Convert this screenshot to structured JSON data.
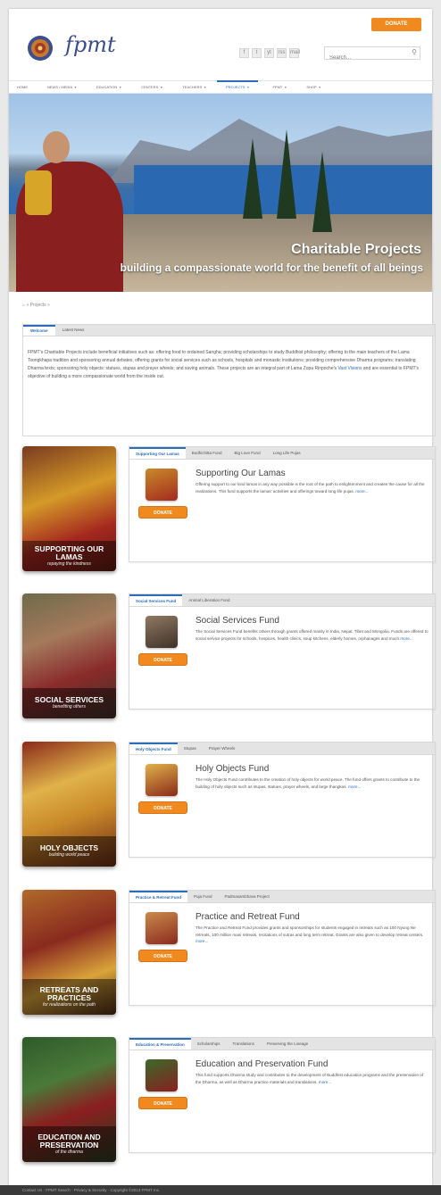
{
  "header": {
    "logo_text": "fpmt",
    "donate_label": "DONATE",
    "social_icons": [
      "f",
      "t",
      "yt",
      "rss",
      "mail"
    ],
    "search_placeholder": "Search...",
    "accent": "#2a6db8",
    "donate_color": "#f0891e"
  },
  "nav": {
    "items": [
      {
        "label": "HOME"
      },
      {
        "label": "NEWS / MEDIA"
      },
      {
        "label": "EDUCATION"
      },
      {
        "label": "CENTERS"
      },
      {
        "label": "TEACHERS"
      },
      {
        "label": "PROJECTS"
      },
      {
        "label": "FPMT"
      },
      {
        "label": "SHOP"
      }
    ],
    "active": "PROJECTS"
  },
  "hero": {
    "title": "Charitable Projects",
    "subtitle": "building a compassionate world for the benefit of all beings"
  },
  "breadcrumb": {
    "current": "Projects"
  },
  "intro": {
    "tabs": [
      "Welcome",
      "Latest News"
    ],
    "text_before_link": "FPMT's Charitable Projects include beneficial initiatives such as: offering food to ordained Sangha; providing scholarships to study Buddhist philosophy; offering to the main teachers of the Lama Tsongkhapa tradition and sponsoring annual debates; offering grants for social services such as schools, hospitals and monastic institutions; providing comprehensive Dharma programs; translating Dharma texts; sponsoring holy objects: statues, stupas and prayer wheels; and saving animals. These projects are an integral part of Lama Zopa Rinpoche's",
    "link": "Vast Visions",
    "text_after_link": "and are essential to FPMT's objective of building a more compassionate world from the inside out."
  },
  "funds": [
    {
      "image_title": "SUPPORTING OUR LAMAS",
      "image_subtitle": "repaying the kindness",
      "tabs": [
        "Supporting Our Lamas",
        "Bodhichitta Fund",
        "Big Love Fund",
        "Long Life Pujas"
      ],
      "title": "Supporting Our Lamas",
      "desc": "Offering support to our kind lamas in any way possible is the root of the path to enlightenment and creates the cause for all the realizations. This fund supports the lamas' activities and offerings toward long life pujas.",
      "more": "more...",
      "donate": "DONATE"
    },
    {
      "image_title": "SOCIAL SERVICES",
      "image_subtitle": "benefiting others",
      "tabs": [
        "Social Services Fund",
        "Animal Liberation Fund"
      ],
      "title": "Social Services Fund",
      "desc": "The Social Services Fund benefits others through grants offered mainly in India, Nepal, Tibet and Mongolia. Funds are offered to social service projects for schools, hospices, health clinics, soup kitchens, elderly homes, orphanages and much",
      "more": "more...",
      "donate": "DONATE"
    },
    {
      "image_title": "HOLY OBJECTS",
      "image_subtitle": "building world peace",
      "tabs": [
        "Holy Objects Fund",
        "Stupas",
        "Prayer Wheels"
      ],
      "title": "Holy Objects Fund",
      "desc": "The Holy Objects Fund contributes to the creation of holy objects for world peace. The fund offers grants to contribute to the building of holy objects such as stupas, statues, prayer wheels, and large thangkas.",
      "more": "more...",
      "donate": "DONATE"
    },
    {
      "image_title": "RETREATS AND PRACTICES",
      "image_subtitle": "for realizations on the path",
      "tabs": [
        "Practice & Retreat Fund",
        "Puja Fund",
        "Padmasambhava Project"
      ],
      "title": "Practice and Retreat Fund",
      "desc": "The Practice and Retreat Fund provides grants and sponsorships for students engaged in retreats such as 100 Nyung Ne retreats, 100 million mani retreats, recitations of sutras and long term retreat. Grants are also given to develop retreat centers.",
      "more": "more...",
      "donate": "DONATE"
    },
    {
      "image_title": "EDUCATION AND PRESERVATION",
      "image_subtitle": "of the dharma",
      "tabs": [
        "Education & Preservation",
        "Scholarships",
        "Translations",
        "Preserving the Lineage"
      ],
      "title": "Education and Preservation Fund",
      "desc": "This fund supports Dharma study and contributes to the development of Buddhist education programs and the preservation of the Dharma, as well as Dharma practice materials and translations.",
      "more": "more...",
      "donate": "DONATE"
    }
  ],
  "footer": {
    "text": "Contact Us  ·  FPMT Search  ·  Privacy & Security  ·  Copyright ©2013 FPMT Inc."
  }
}
